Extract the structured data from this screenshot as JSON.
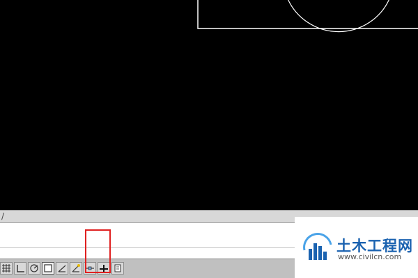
{
  "watermark": {
    "site_name": "土木工程网",
    "site_url": "www.civilcn.com"
  },
  "scroll_strip": {
    "glyph": "/"
  },
  "status_bar": {
    "buttons": [
      {
        "name": "snap-grid-icon"
      },
      {
        "name": "ortho-icon"
      },
      {
        "name": "polar-tracking-icon"
      },
      {
        "name": "object-snap-icon"
      },
      {
        "name": "object-snap-tracking-icon"
      },
      {
        "name": "dynamic-ucs-icon"
      },
      {
        "name": "dynamic-input-icon"
      },
      {
        "name": "lineweight-icon"
      },
      {
        "name": "selection-cycling-icon"
      },
      {
        "name": "quick-properties-icon"
      }
    ],
    "highlighted_button": "selection-cycling-icon"
  },
  "colors": {
    "canvas_bg": "#000000",
    "drawing_lines": "#ffffff",
    "highlight": "#e02020",
    "brand_blue": "#1a62b0"
  }
}
